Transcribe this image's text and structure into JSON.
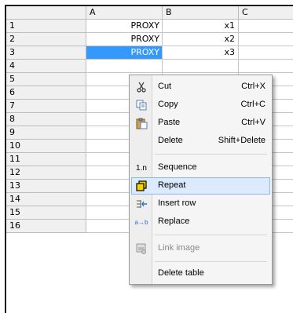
{
  "sheet": {
    "columns": [
      "A",
      "B",
      "C"
    ],
    "rows": [
      {
        "num": "1",
        "a": "PROXY",
        "b": "x1"
      },
      {
        "num": "2",
        "a": "PROXY",
        "b": "x2"
      },
      {
        "num": "3",
        "a": "PROXY",
        "b": "x3"
      },
      {
        "num": "4",
        "a": "",
        "b": ""
      },
      {
        "num": "5",
        "a": "",
        "b": ""
      },
      {
        "num": "6",
        "a": "",
        "b": ""
      },
      {
        "num": "7",
        "a": "",
        "b": ""
      },
      {
        "num": "8",
        "a": "",
        "b": ""
      },
      {
        "num": "9",
        "a": "",
        "b": ""
      },
      {
        "num": "10",
        "a": "",
        "b": ""
      },
      {
        "num": "11",
        "a": "",
        "b": ""
      },
      {
        "num": "12",
        "a": "",
        "b": ""
      },
      {
        "num": "13",
        "a": "",
        "b": ""
      },
      {
        "num": "14",
        "a": "",
        "b": ""
      },
      {
        "num": "15",
        "a": "",
        "b": ""
      },
      {
        "num": "16",
        "a": "",
        "b": ""
      }
    ],
    "selected_cell": "A3"
  },
  "menu": {
    "cut": {
      "label": "Cut",
      "shortcut": "Ctrl+X",
      "icon": "scissors-icon"
    },
    "copy": {
      "label": "Copy",
      "shortcut": "Ctrl+C",
      "icon": "copy-icon"
    },
    "paste": {
      "label": "Paste",
      "shortcut": "Ctrl+V",
      "icon": "paste-icon"
    },
    "delete": {
      "label": "Delete",
      "shortcut": "Shift+Delete"
    },
    "sequence": {
      "label": "Sequence",
      "icon_text": "1.n"
    },
    "repeat": {
      "label": "Repeat",
      "icon": "repeat-icon",
      "highlighted": true
    },
    "insert_row": {
      "label": "Insert row",
      "icon": "insert-row-icon"
    },
    "replace": {
      "label": "Replace",
      "icon_text": "a→b"
    },
    "link_image": {
      "label": "Link image",
      "icon": "link-image-icon",
      "disabled": true
    },
    "delete_table": {
      "label": "Delete table"
    }
  },
  "colors": {
    "selection": "#3399ff",
    "menu_highlight": "#dbeaff",
    "header_bg": "#f0f0f0"
  }
}
